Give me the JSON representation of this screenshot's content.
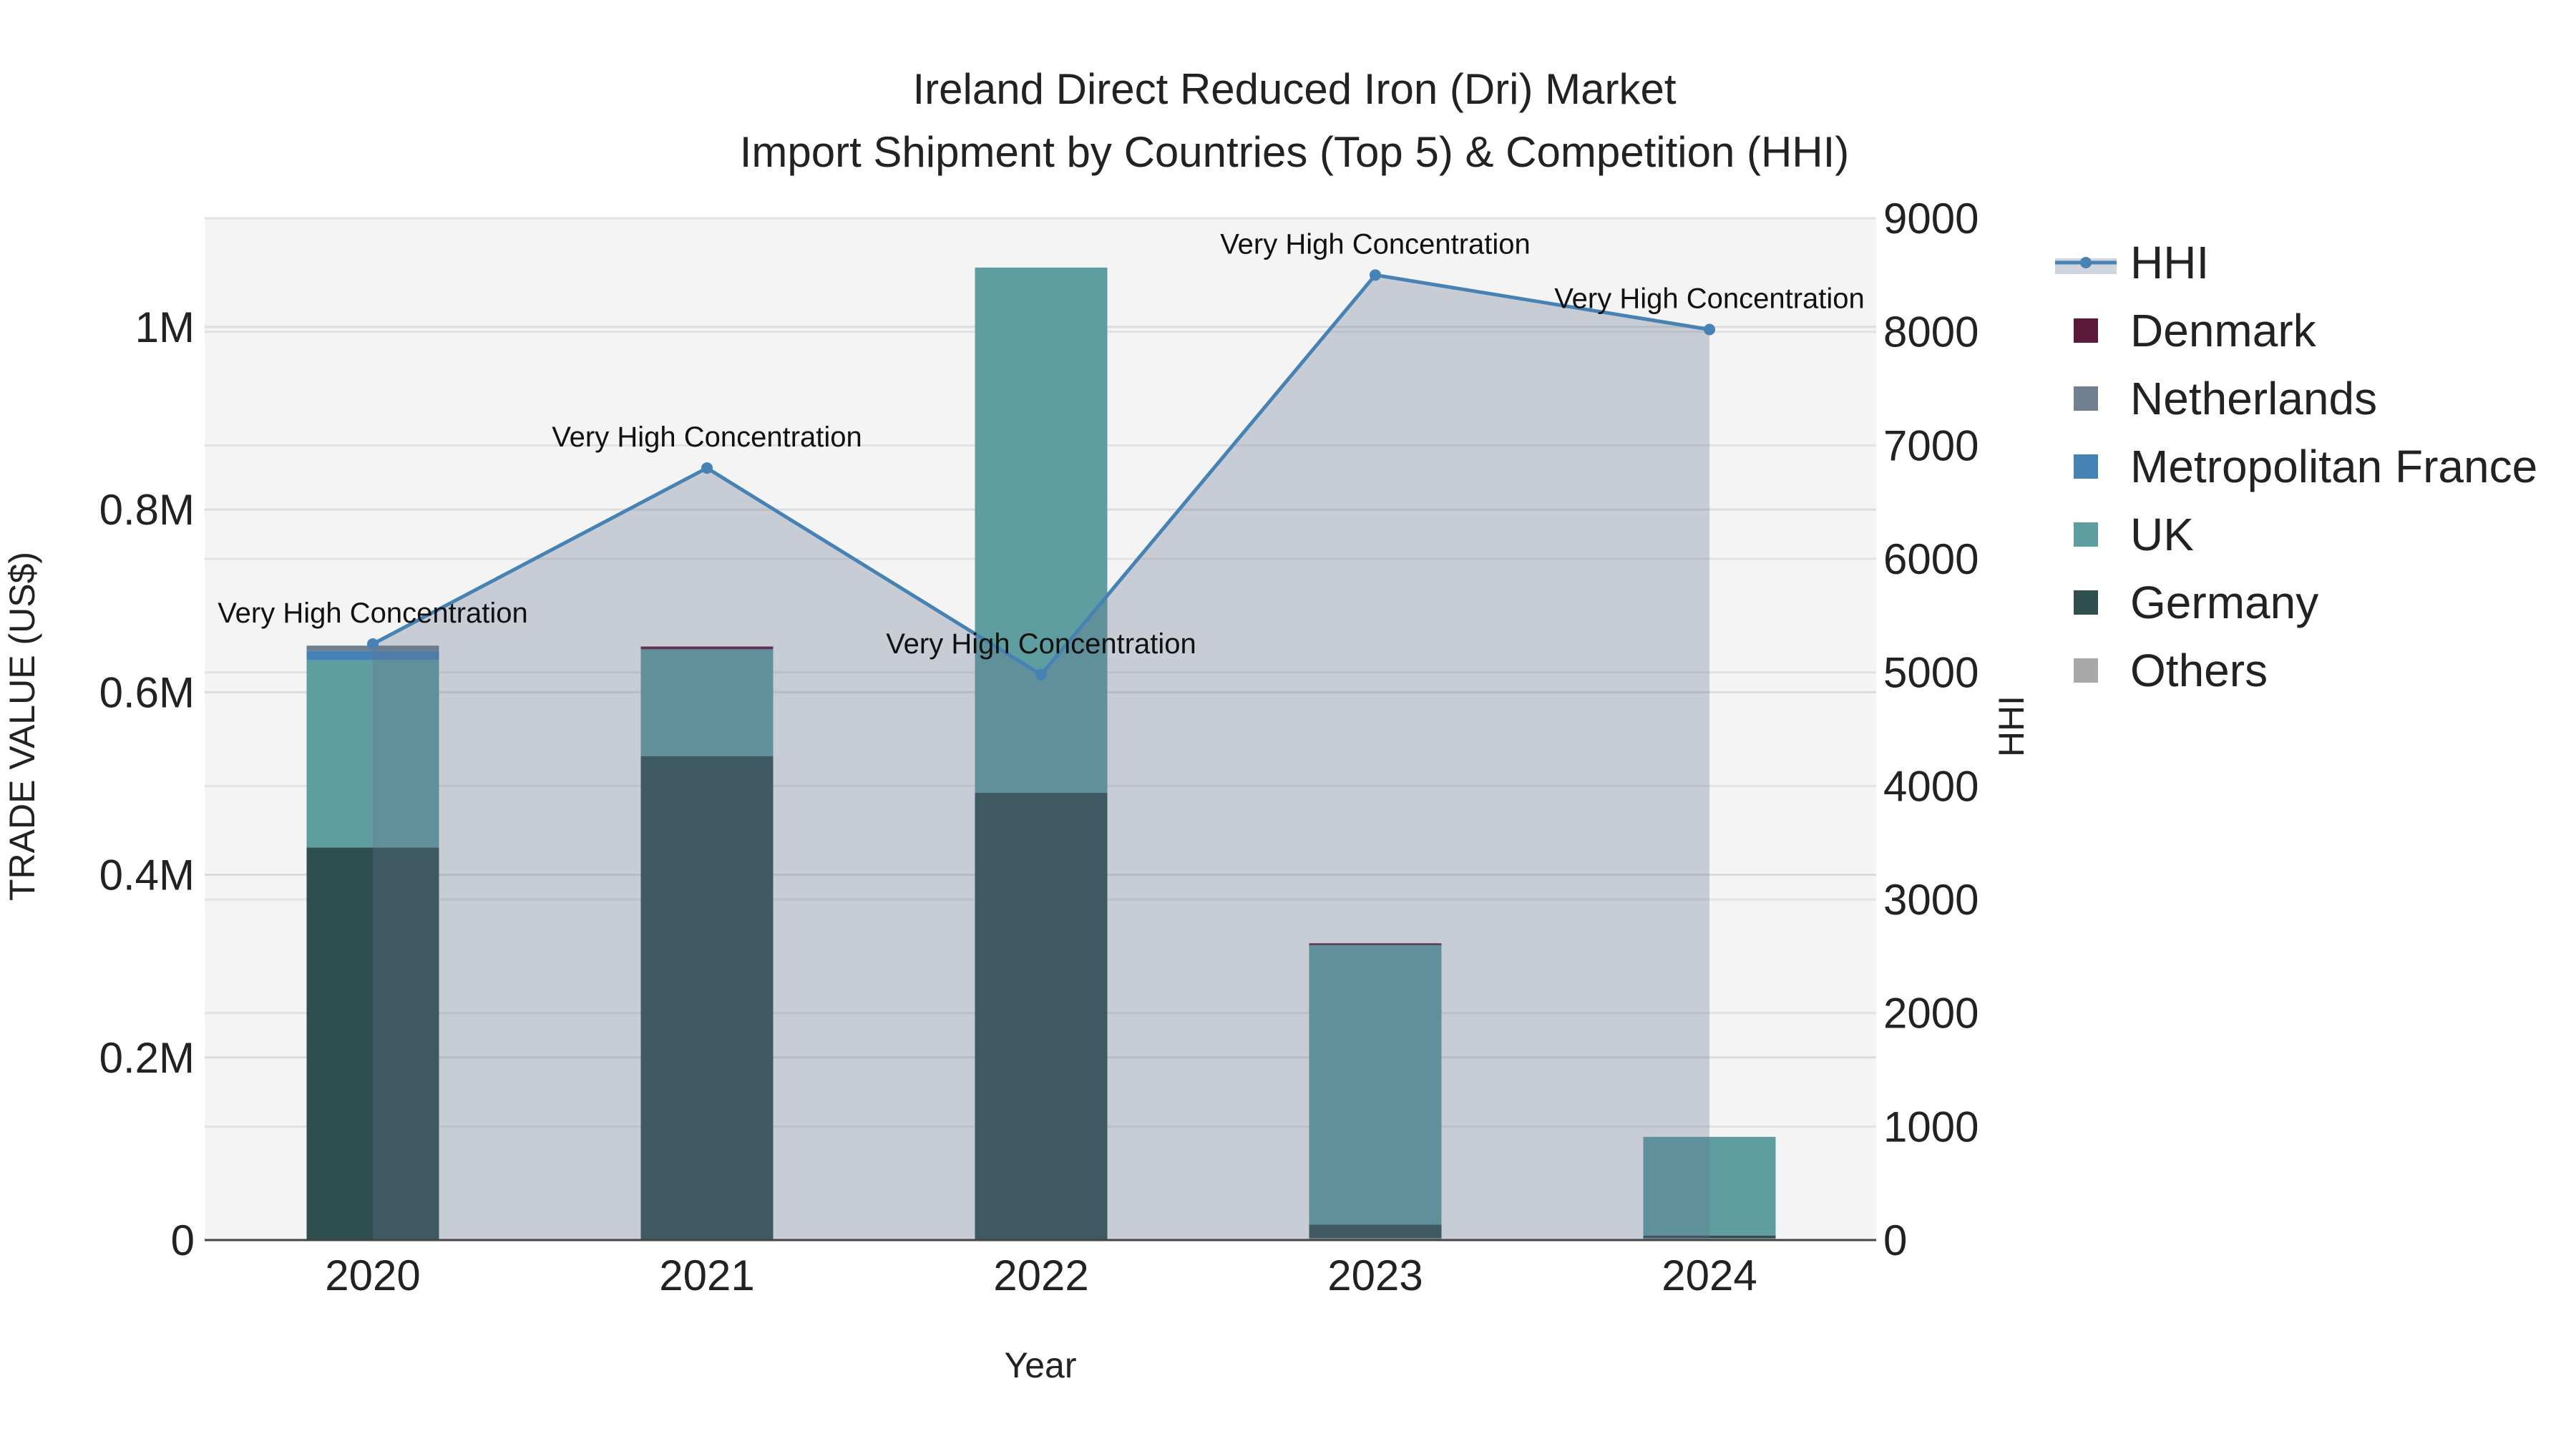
{
  "chart_data": {
    "type": "bar",
    "title": "Ireland Direct Reduced Iron (Dri) Market",
    "subtitle": "Import Shipment by Countries (Top 5) & Competition (HHI)",
    "xlabel": "Year",
    "ylabel": "TRADE VALUE (US$)",
    "y2label": "HHI",
    "categories": [
      "2020",
      "2021",
      "2022",
      "2023",
      "2024"
    ],
    "ylim": [
      0,
      1.119
    ],
    "y_ticks": [
      0,
      0.2,
      0.4,
      0.6,
      0.8,
      1.0
    ],
    "y_tick_labels": [
      "0",
      "0.2M",
      "0.4M",
      "0.6M",
      "0.8M",
      "1M"
    ],
    "y2lim": [
      0,
      9000
    ],
    "y2_ticks": [
      0,
      1000,
      2000,
      3000,
      4000,
      5000,
      6000,
      7000,
      8000,
      9000
    ],
    "y2_tick_labels": [
      "0",
      "1000",
      "2000",
      "3000",
      "4000",
      "5000",
      "6000",
      "7000",
      "8000",
      "9000"
    ],
    "grid": true,
    "legend_position": "right",
    "series": [
      {
        "name": "Others",
        "color": "#a9a9a9",
        "values": [
          0,
          0,
          0,
          0.002,
          0.002
        ]
      },
      {
        "name": "Germany",
        "color": "#2f4f4f",
        "values": [
          0.43,
          0.53,
          0.49,
          0.015,
          0.003
        ]
      },
      {
        "name": "UK",
        "color": "#5f9ea0",
        "values": [
          0.205,
          0.117,
          0.575,
          0.306,
          0.108
        ]
      },
      {
        "name": "Metropolitan France",
        "color": "#4682b4",
        "values": [
          0.01,
          0,
          0,
          0,
          0
        ]
      },
      {
        "name": "Netherlands",
        "color": "#708090",
        "values": [
          0.006,
          0,
          0,
          0,
          0
        ]
      },
      {
        "name": "Denmark",
        "color": "#5c1a3b",
        "values": [
          0,
          0.003,
          0,
          0.002,
          0
        ]
      }
    ],
    "hhi": {
      "name": "HHI",
      "color": "#4682b4",
      "values": [
        5250,
        6800,
        4980,
        8500,
        8020
      ],
      "annotations": [
        "Very High Concentration",
        "Very High Concentration",
        "Very High Concentration",
        "Very High Concentration",
        "Very High Concentration"
      ]
    },
    "legend": [
      "HHI",
      "Denmark",
      "Netherlands",
      "Metropolitan France",
      "UK",
      "Germany",
      "Others"
    ]
  }
}
